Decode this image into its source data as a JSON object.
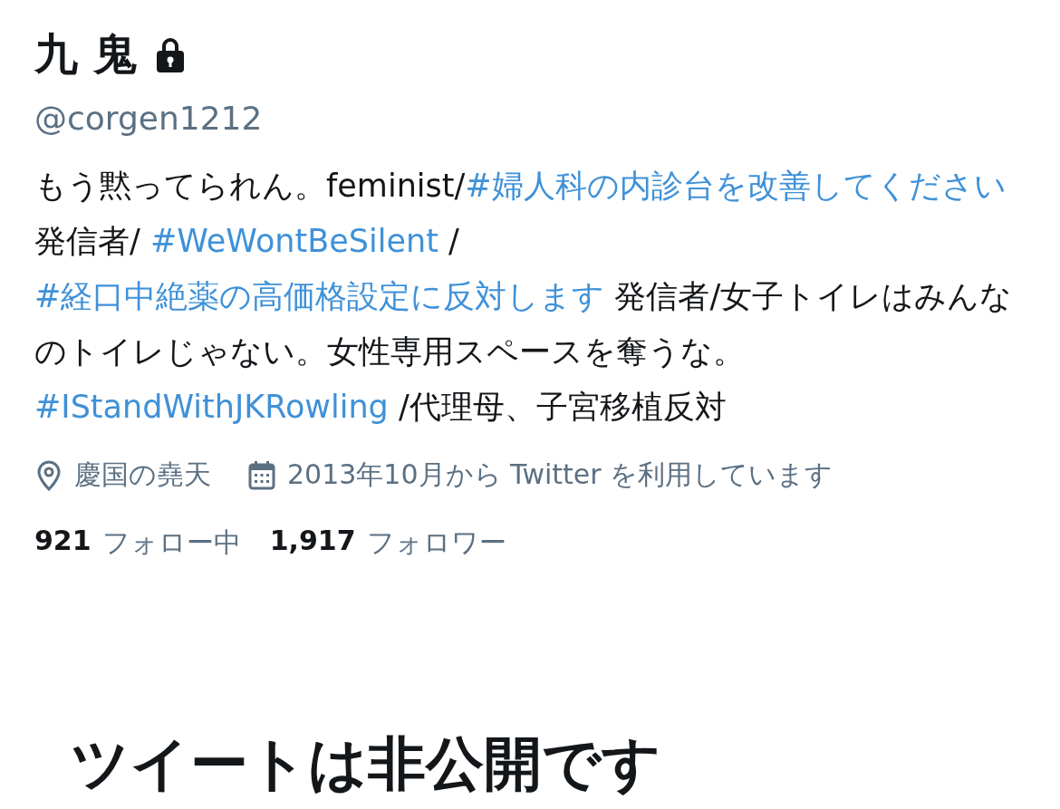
{
  "profile": {
    "name": "九 鬼",
    "protected": true,
    "handle": "@corgen1212",
    "bio": [
      {
        "kind": "text",
        "text": "もう黙ってられん。feminist/"
      },
      {
        "kind": "hashtag",
        "text": "#婦人科の内診台を改善してください"
      },
      {
        "kind": "text",
        "text": " 発信者/ "
      },
      {
        "kind": "hashtag",
        "text": "#WeWontBeSilent"
      },
      {
        "kind": "text",
        "text": " / "
      },
      {
        "kind": "hashtag",
        "text": "#経口中絶薬の高価格設定に反対します"
      },
      {
        "kind": "text",
        "text": " 発信者/女子トイレはみんなのトイレじゃない。女性専用スペースを奪うな。"
      },
      {
        "kind": "hashtag",
        "text": "#IStandWithJKRowling"
      },
      {
        "kind": "text",
        "text": " /代理母、子宮移植反対"
      }
    ],
    "meta": [
      {
        "kind": "location",
        "text": "慶国の堯天"
      },
      {
        "kind": "joined",
        "text": "2013年10月から Twitter を利用しています"
      }
    ],
    "counts": [
      {
        "number": "921",
        "label": "フォロー中"
      },
      {
        "number": "1,917",
        "label": "フォロワー"
      }
    ]
  },
  "notice": {
    "title": "ツイートは非公開です"
  }
}
